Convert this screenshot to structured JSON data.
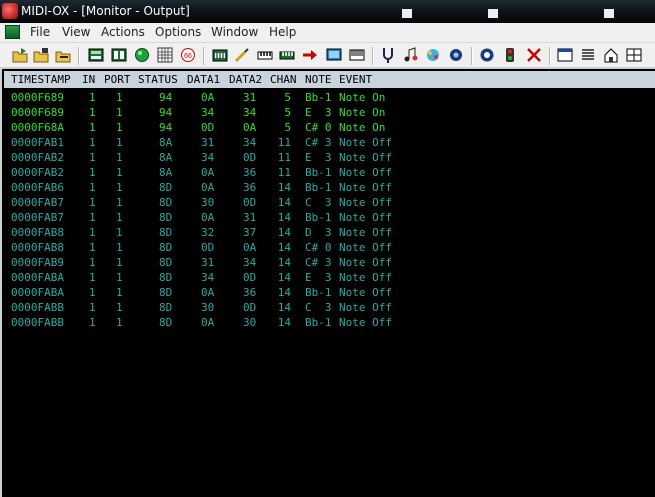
{
  "window": {
    "title": "MIDI-OX - [Monitor - Output]"
  },
  "menu": [
    "File",
    "View",
    "Actions",
    "Options",
    "Window",
    "Help"
  ],
  "toolbar": {
    "icons": [
      "open-icon",
      "save-icon",
      "save-as-icon",
      "piano-roll-icon",
      "options-icon",
      "green-ball-icon",
      "grid-icon",
      "sysex-icon",
      "instrument-icon",
      "keyboard-brush-icon",
      "keyboard-icon",
      "controller-icon",
      "red-arrow-icon",
      "monitor-icon",
      "keys-icon",
      "tuning-fork-icon",
      "notes-icon",
      "color-icon",
      "dot-icon",
      "stop-icon",
      "traffic-light-icon",
      "close-icon",
      "window-icon",
      "lines-icon",
      "house-icon",
      "split-icon"
    ]
  },
  "monitor": {
    "columns": [
      "TIMESTAMP",
      "IN",
      "PORT",
      "STATUS",
      "DATA1",
      "DATA2",
      "CHAN",
      "NOTE",
      "EVENT"
    ],
    "rows": [
      {
        "timestamp": "0000F689",
        "in": "1",
        "port": "1",
        "status": "94",
        "data1": "0A",
        "data2": "31",
        "chan": "5",
        "note": "Bb-1",
        "event": "Note On"
      },
      {
        "timestamp": "0000F689",
        "in": "1",
        "port": "1",
        "status": "94",
        "data1": "34",
        "data2": "34",
        "chan": "5",
        "note": "E  3",
        "event": "Note On"
      },
      {
        "timestamp": "0000F68A",
        "in": "1",
        "port": "1",
        "status": "94",
        "data1": "0D",
        "data2": "0A",
        "chan": "5",
        "note": "C# 0",
        "event": "Note On"
      },
      {
        "timestamp": "0000FAB1",
        "in": "1",
        "port": "1",
        "status": "8A",
        "data1": "31",
        "data2": "34",
        "chan": "11",
        "note": "C# 3",
        "event": "Note Off"
      },
      {
        "timestamp": "0000FAB2",
        "in": "1",
        "port": "1",
        "status": "8A",
        "data1": "34",
        "data2": "0D",
        "chan": "11",
        "note": "E  3",
        "event": "Note Off"
      },
      {
        "timestamp": "0000FAB2",
        "in": "1",
        "port": "1",
        "status": "8A",
        "data1": "0A",
        "data2": "36",
        "chan": "11",
        "note": "Bb-1",
        "event": "Note Off"
      },
      {
        "timestamp": "0000FAB6",
        "in": "1",
        "port": "1",
        "status": "8D",
        "data1": "0A",
        "data2": "36",
        "chan": "14",
        "note": "Bb-1",
        "event": "Note Off"
      },
      {
        "timestamp": "0000FAB7",
        "in": "1",
        "port": "1",
        "status": "8D",
        "data1": "30",
        "data2": "0D",
        "chan": "14",
        "note": "C  3",
        "event": "Note Off"
      },
      {
        "timestamp": "0000FAB7",
        "in": "1",
        "port": "1",
        "status": "8D",
        "data1": "0A",
        "data2": "31",
        "chan": "14",
        "note": "Bb-1",
        "event": "Note Off"
      },
      {
        "timestamp": "0000FAB8",
        "in": "1",
        "port": "1",
        "status": "8D",
        "data1": "32",
        "data2": "37",
        "chan": "14",
        "note": "D  3",
        "event": "Note Off"
      },
      {
        "timestamp": "0000FAB8",
        "in": "1",
        "port": "1",
        "status": "8D",
        "data1": "0D",
        "data2": "0A",
        "chan": "14",
        "note": "C# 0",
        "event": "Note Off"
      },
      {
        "timestamp": "0000FAB9",
        "in": "1",
        "port": "1",
        "status": "8D",
        "data1": "31",
        "data2": "34",
        "chan": "14",
        "note": "C# 3",
        "event": "Note Off"
      },
      {
        "timestamp": "0000FABA",
        "in": "1",
        "port": "1",
        "status": "8D",
        "data1": "34",
        "data2": "0D",
        "chan": "14",
        "note": "E  3",
        "event": "Note Off"
      },
      {
        "timestamp": "0000FABA",
        "in": "1",
        "port": "1",
        "status": "8D",
        "data1": "0A",
        "data2": "36",
        "chan": "14",
        "note": "Bb-1",
        "event": "Note Off"
      },
      {
        "timestamp": "0000FABB",
        "in": "1",
        "port": "1",
        "status": "8D",
        "data1": "30",
        "data2": "0D",
        "chan": "14",
        "note": "C  3",
        "event": "Note Off"
      },
      {
        "timestamp": "0000FABB",
        "in": "1",
        "port": "1",
        "status": "8D",
        "data1": "0A",
        "data2": "30",
        "chan": "14",
        "note": "Bb-1",
        "event": "Note Off"
      }
    ]
  },
  "colors": {
    "note_on": "#33dd33",
    "note_off": "#2ba9a0",
    "header_bg": "#c8d3dd",
    "background": "#000000"
  }
}
